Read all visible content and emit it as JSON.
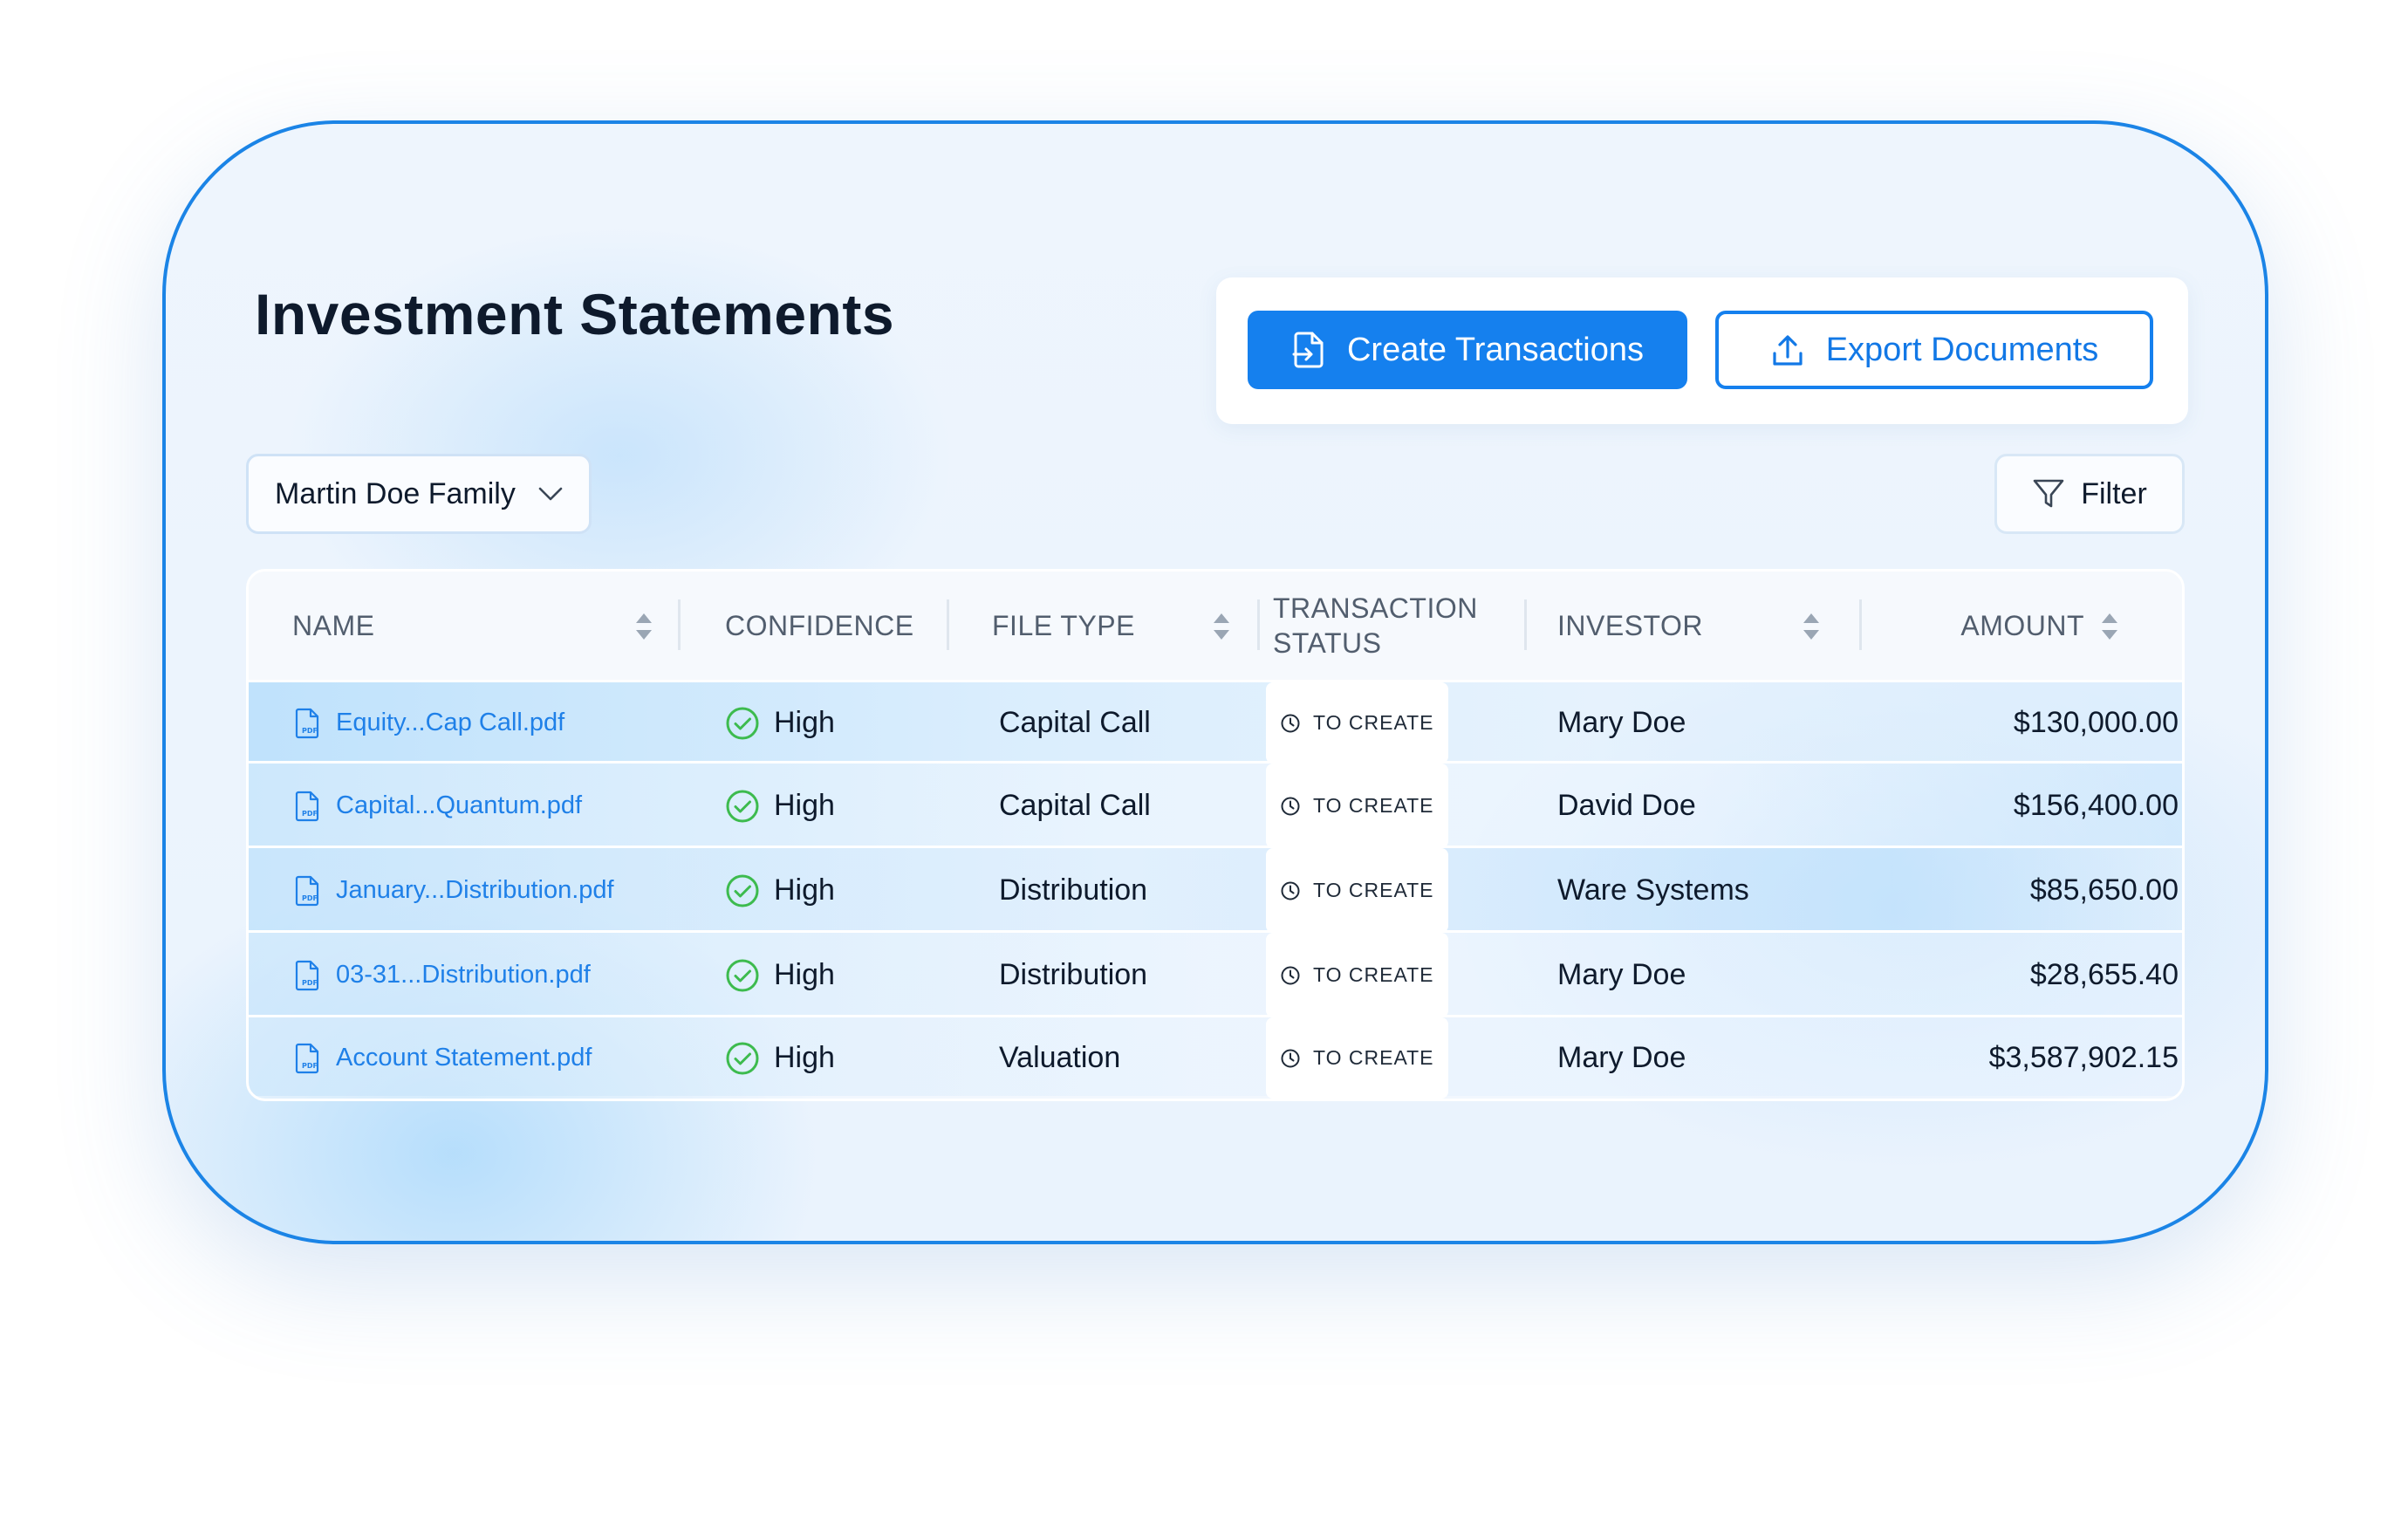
{
  "page_title": "Investment Statements",
  "actions": {
    "create_label": "Create Transactions",
    "export_label": "Export Documents"
  },
  "family_select": {
    "value": "Martin Doe Family"
  },
  "filter_label": "Filter",
  "columns": {
    "name": "NAME",
    "confidence": "CONFIDENCE",
    "file_type": "FILE TYPE",
    "transaction_status": "TRANSACTION\nSTATUS",
    "investor": "INVESTOR",
    "amount": "AMOUNT"
  },
  "rows": [
    {
      "file": "Equity...Cap Call.pdf",
      "confidence": "High",
      "file_type": "Capital Call",
      "status": "TO CREATE",
      "investor": "Mary Doe",
      "amount": "$130,000.00"
    },
    {
      "file": "Capital...Quantum.pdf",
      "confidence": "High",
      "file_type": "Capital Call",
      "status": "TO CREATE",
      "investor": "David Doe",
      "amount": "$156,400.00"
    },
    {
      "file": "January...Distribution.pdf",
      "confidence": "High",
      "file_type": "Distribution",
      "status": "TO CREATE",
      "investor": "Ware Systems",
      "amount": "$85,650.00"
    },
    {
      "file": "03-31...Distribution.pdf",
      "confidence": "High",
      "file_type": "Distribution",
      "status": "TO CREATE",
      "investor": "Mary Doe",
      "amount": "$28,655.40"
    },
    {
      "file": "Account Statement.pdf",
      "confidence": "High",
      "file_type": "Valuation",
      "status": "TO CREATE",
      "investor": "Mary Doe",
      "amount": "$3,587,902.15"
    }
  ],
  "colors": {
    "accent": "#1580ee",
    "border": "#1b84e6",
    "success": "#3dbb4e",
    "link": "#1f80e8"
  },
  "icons": {
    "create": "file-transfer-icon",
    "export": "upload-icon",
    "select_chevron": "chevron-down-icon",
    "filter": "funnel-icon",
    "sort": "sort-arrows-icon",
    "file": "pdf-file-icon",
    "confidence": "check-circle-icon",
    "status": "clock-icon"
  }
}
